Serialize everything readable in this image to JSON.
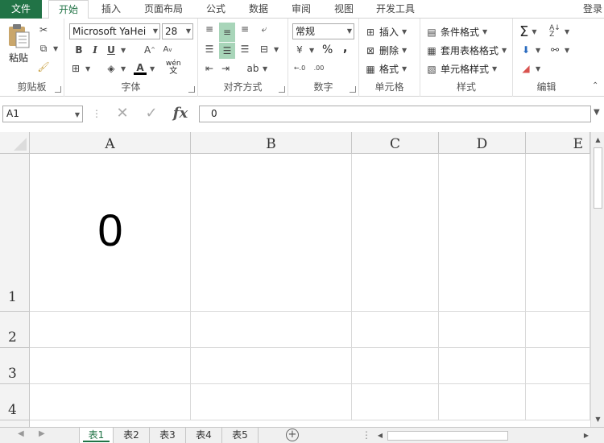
{
  "tabs": [
    "文件",
    "开始",
    "插入",
    "页面布局",
    "公式",
    "数据",
    "审阅",
    "视图",
    "开发工具"
  ],
  "active_tab": "开始",
  "login": "登录",
  "ribbon": {
    "clipboard": {
      "label": "剪贴板",
      "paste": "粘贴"
    },
    "font": {
      "label": "字体",
      "family": "Microsoft YaHei",
      "size": "28",
      "phonetic": "wén"
    },
    "alignment": {
      "label": "对齐方式"
    },
    "number": {
      "label": "数字",
      "format": "常规",
      "percent": "%",
      "comma": ","
    },
    "cells": {
      "label": "单元格",
      "insert": "插入",
      "delete": "删除",
      "format": "格式"
    },
    "styles": {
      "label": "样式",
      "conditional": "条件格式",
      "table": "套用表格格式",
      "cell_styles": "单元格样式"
    },
    "editing": {
      "label": "编辑"
    }
  },
  "formula_bar": {
    "name_box": "A1",
    "content": "0",
    "fx": "fx"
  },
  "columns": [
    "A",
    "B",
    "C",
    "D",
    "E"
  ],
  "rows": [
    "1",
    "2",
    "3",
    "4"
  ],
  "cells": {
    "A1": "0"
  },
  "sheets": [
    "表1",
    "表2",
    "表3",
    "表4",
    "表5"
  ],
  "active_sheet": "表1",
  "accent_color": "#217346"
}
